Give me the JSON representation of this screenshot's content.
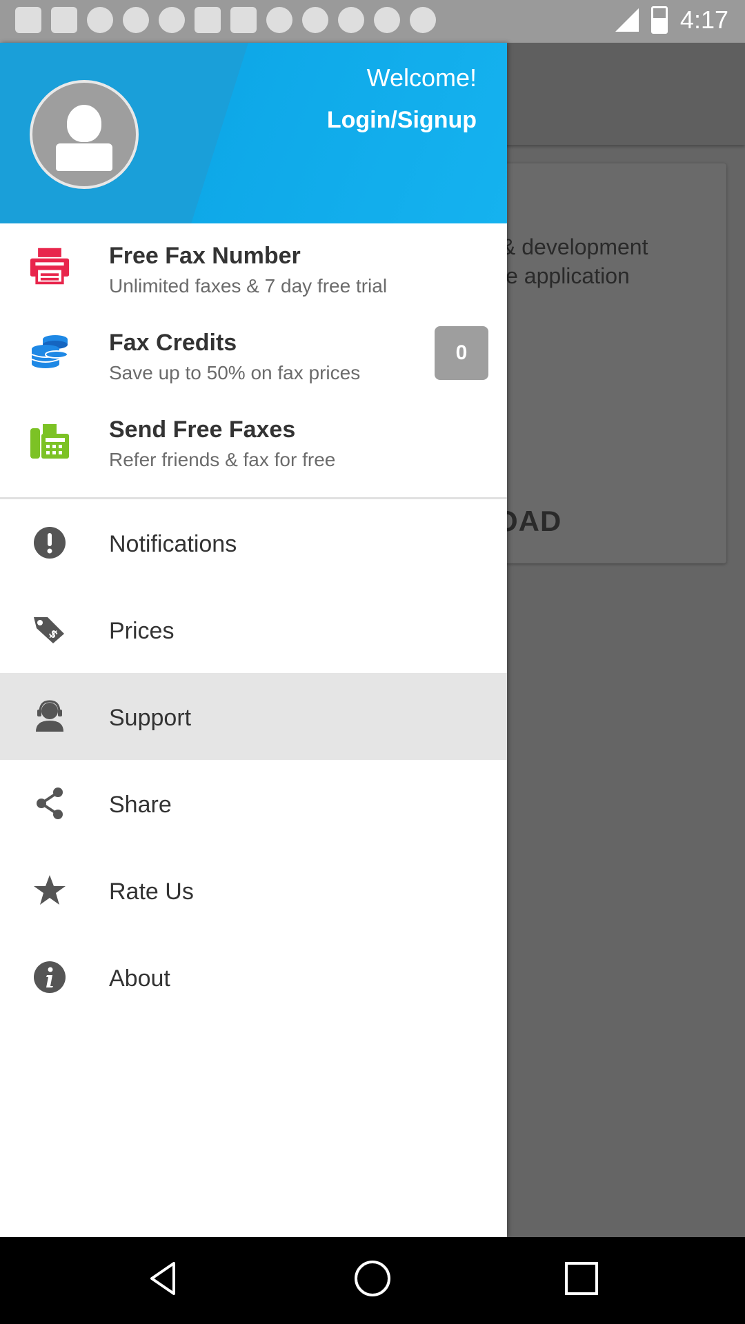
{
  "status_bar": {
    "time": "4:17"
  },
  "background": {
    "card_text_line1": "& development",
    "card_text_line2": "le application",
    "card_button": "OAD"
  },
  "drawer": {
    "header": {
      "welcome": "Welcome!",
      "login": "Login/Signup"
    },
    "feature_items": [
      {
        "title": "Free Fax Number",
        "subtitle": "Unlimited faxes & 7 day free trial",
        "icon": "fax-printer-icon"
      },
      {
        "title": "Fax Credits",
        "subtitle": "Save up to 50% on fax prices",
        "icon": "coins-icon",
        "badge": "0"
      },
      {
        "title": "Send Free Faxes",
        "subtitle": "Refer friends & fax for free",
        "icon": "fax-machine-icon"
      }
    ],
    "menu_items": [
      {
        "label": "Notifications",
        "icon": "exclamation-icon"
      },
      {
        "label": "Prices",
        "icon": "price-tag-icon"
      },
      {
        "label": "Support",
        "icon": "support-agent-icon",
        "selected": true
      },
      {
        "label": "Share",
        "icon": "share-icon"
      },
      {
        "label": "Rate Us",
        "icon": "star-icon"
      },
      {
        "label": "About",
        "icon": "info-icon"
      }
    ]
  },
  "colors": {
    "accent": "#1AA7E3",
    "fax_red": "#E8264C",
    "coins_blue": "#1E88E5",
    "fax_green": "#7CC225"
  }
}
